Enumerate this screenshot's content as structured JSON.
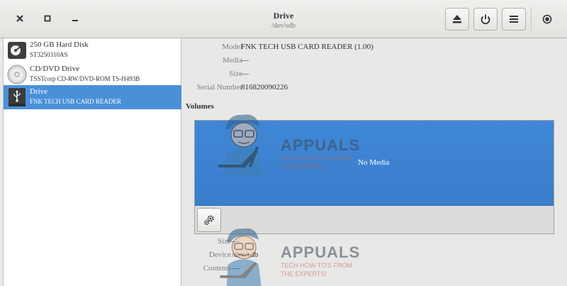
{
  "window": {
    "title": "Drive",
    "subtitle": "/dev/sdb"
  },
  "header": {
    "buttons": [
      "close-icon",
      "maximize-icon",
      "minimize-icon",
      "eject-icon",
      "power-icon",
      "menu-icon",
      "record-icon"
    ]
  },
  "sidebar": {
    "items": [
      {
        "name": "250 GB Hard Disk",
        "desc": "ST3250310AS",
        "icon": "hard-disk-icon",
        "selected": false
      },
      {
        "name": "CD/DVD Drive",
        "desc": "TSSTcorp CD-RW/DVD-ROM TS-H493B",
        "icon": "optical-disc-icon",
        "selected": false
      },
      {
        "name": "Drive",
        "desc": "FNK TECH USB CARD READER",
        "icon": "usb-drive-icon",
        "selected": true
      }
    ]
  },
  "properties": [
    {
      "label": "Model",
      "value": "FNK TECH USB CARD READER (1.00)"
    },
    {
      "label": "Media",
      "value": "—"
    },
    {
      "label": "Size",
      "value": "—"
    },
    {
      "label": "Serial Number",
      "value": "816820090226"
    }
  ],
  "volumes": {
    "title": "Volumes",
    "bar_label": "No Media",
    "bar_color": "#3f87d6",
    "details": [
      {
        "label": "Size",
        "value": "—"
      },
      {
        "label": "Device",
        "value": "/dev/sdb"
      },
      {
        "label": "Contents",
        "value": "—"
      }
    ]
  },
  "watermark": {
    "brand": "APPUALS",
    "tagline_1": "TECH HOW-TO'S FROM",
    "tagline_2": "THE EXPERTS!"
  },
  "colors": {
    "selection": "#4a90d9",
    "background": "#e8e8e7"
  }
}
